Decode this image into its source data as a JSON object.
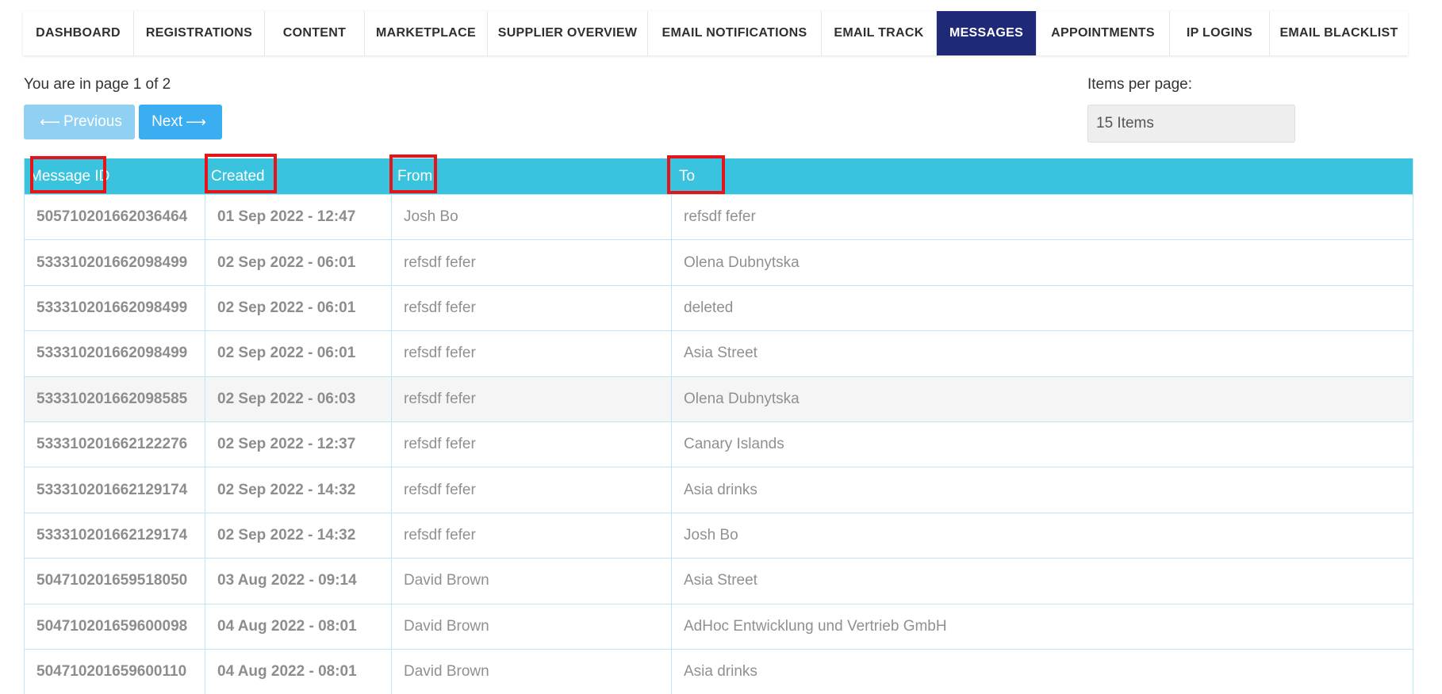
{
  "tabs": [
    {
      "label": "DASHBOARD",
      "active": false
    },
    {
      "label": "REGISTRATIONS",
      "active": false
    },
    {
      "label": "CONTENT",
      "active": false
    },
    {
      "label": "MARKETPLACE",
      "active": false
    },
    {
      "label": "SUPPLIER OVERVIEW",
      "active": false
    },
    {
      "label": "EMAIL NOTIFICATIONS",
      "active": false
    },
    {
      "label": "EMAIL TRACK",
      "active": false
    },
    {
      "label": "MESSAGES",
      "active": true
    },
    {
      "label": "APPOINTMENTS",
      "active": false
    },
    {
      "label": "IP LOGINS",
      "active": false
    },
    {
      "label": "EMAIL BLACKLIST",
      "active": false
    }
  ],
  "pagination": {
    "info": "You are in page 1 of 2",
    "previous_label": "Previous",
    "next_label": "Next"
  },
  "items_per_page": {
    "label": "Items per page:",
    "value": "15 Items"
  },
  "table": {
    "columns": [
      "Message ID",
      "Created",
      "From",
      "To"
    ],
    "rows": [
      [
        "505710201662036464",
        "01 Sep 2022 - 12:47",
        "Josh Bo",
        "refsdf fefer"
      ],
      [
        "533310201662098499",
        "02 Sep 2022 - 06:01",
        "refsdf fefer",
        "Olena Dubnytska"
      ],
      [
        "533310201662098499",
        "02 Sep 2022 - 06:01",
        "refsdf fefer",
        "deleted"
      ],
      [
        "533310201662098499",
        "02 Sep 2022 - 06:01",
        "refsdf fefer",
        "Asia Street"
      ],
      [
        "533310201662098585",
        "02 Sep 2022 - 06:03",
        "refsdf fefer",
        "Olena Dubnytska"
      ],
      [
        "533310201662122276",
        "02 Sep 2022 - 12:37",
        "refsdf fefer",
        "Canary Islands"
      ],
      [
        "533310201662129174",
        "02 Sep 2022 - 14:32",
        "refsdf fefer",
        "Asia drinks"
      ],
      [
        "533310201662129174",
        "02 Sep 2022 - 14:32",
        "refsdf fefer",
        "Josh Bo"
      ],
      [
        "504710201659518050",
        "03 Aug 2022 - 09:14",
        "David Brown",
        "Asia Street"
      ],
      [
        "504710201659600098",
        "04 Aug 2022 - 08:01",
        "David Brown",
        "AdHoc Entwicklung und Vertrieb GmbH"
      ],
      [
        "504710201659600110",
        "04 Aug 2022 - 08:01",
        "David Brown",
        "Asia drinks"
      ]
    ]
  },
  "colors": {
    "active_tab": "#1e2a78",
    "table_header": "#3ac3de",
    "next_button": "#3aaef0",
    "previous_button": "#8fd0f3",
    "highlight_box": "#e4141b"
  }
}
